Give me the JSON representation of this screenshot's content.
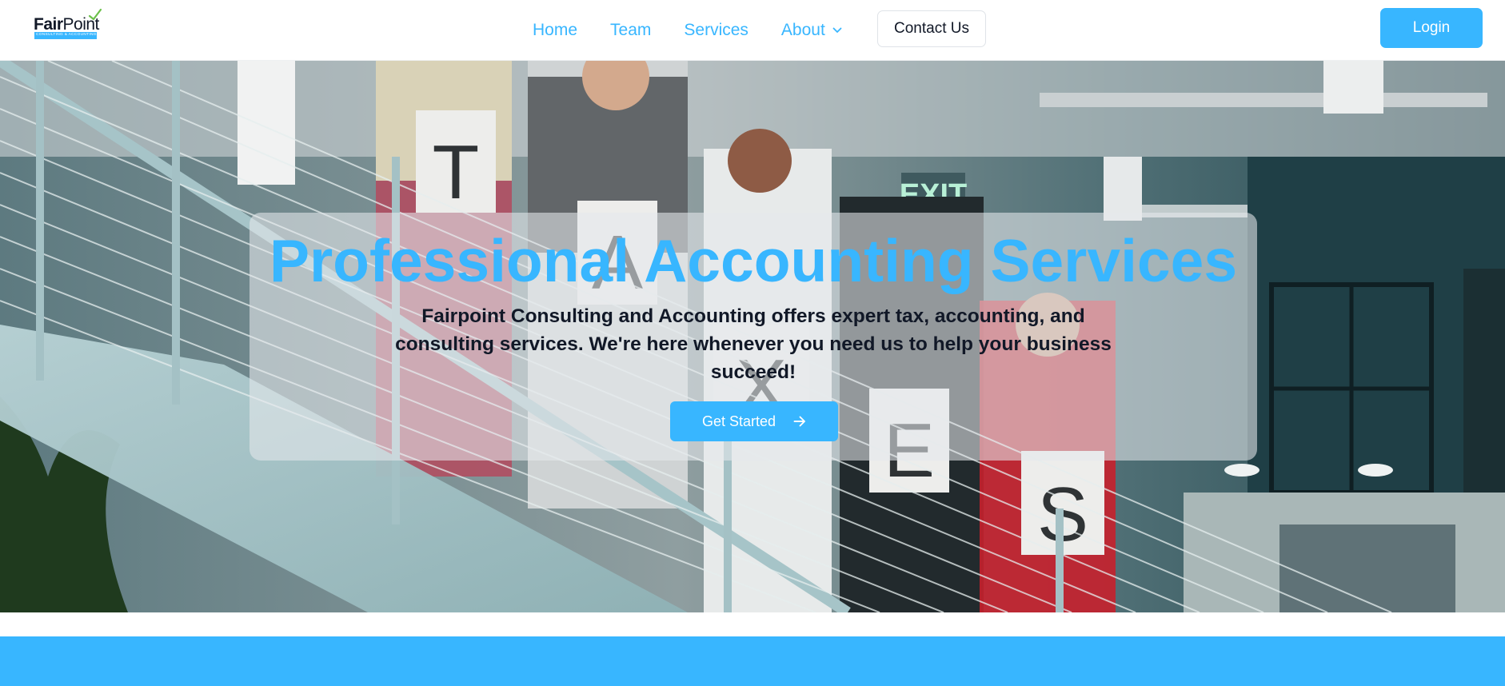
{
  "header": {
    "logo": {
      "name": "FairPoint",
      "name_bold": "Fair",
      "name_light": "Point",
      "tagline": "CONSULTING & ACCOUNTING"
    },
    "nav": [
      {
        "label": "Home"
      },
      {
        "label": "Team"
      },
      {
        "label": "Services"
      },
      {
        "label": "About"
      }
    ],
    "contact_label": "Contact Us",
    "login_label": "Login"
  },
  "hero": {
    "title": "Professional Accounting Services",
    "subtitle": "Fairpoint Consulting and Accounting offers expert tax, accounting, and consulting services. We're here whenever you need us to help your business succeed!",
    "cta_label": "Get Started",
    "image": {
      "sign_letters": [
        "T",
        "A",
        "X",
        "E",
        "S"
      ],
      "exit_sign": "EXIT"
    }
  },
  "colors": {
    "accent": "#38b6ff",
    "text_dark": "#111827",
    "white": "#ffffff"
  },
  "icons": {
    "about_dropdown": "chevron-down-icon",
    "cta_arrow": "arrow-right-icon",
    "logo_mark": "checkmark-icon"
  }
}
